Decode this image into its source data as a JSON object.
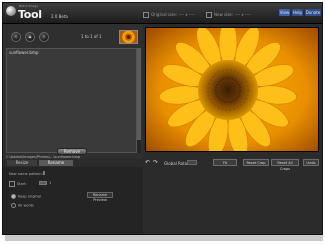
{
  "app": {
    "brand_small": "Batch Image",
    "brand": "Tool",
    "version": "2.0 Beta"
  },
  "title_info": {
    "original": "Original size: ---- x ----",
    "new_size": "New size: ---- x ----"
  },
  "top_buttons": {
    "view": "View",
    "help": "Help",
    "donate": "Donate"
  },
  "toolbar": {
    "prev_icon": "previous-icon",
    "open_icon": "open-icon",
    "next_icon": "next-icon",
    "counter": "1 to 1 of 1"
  },
  "file_list": {
    "items": [
      "sunflower.bmp"
    ]
  },
  "file_path": "C:\\Adobe\\Images\\Photos\\...\\sunflower.bmp",
  "remove_button": "Remove",
  "tabs": {
    "resize": "Resize",
    "rename": "Rename"
  },
  "rename_panel": {
    "new_name_label": "New name pattern:",
    "start_label": "Start:",
    "start_value": "1",
    "option1_label": "Keep original",
    "option2_label": "All words",
    "rename_button": "Rename Preview"
  },
  "bottom_bar": {
    "rotation_label": "Global Rotation:",
    "btn_fit": "Fit",
    "btn_reset_crop": "Reset Crop",
    "btn_reset_all": "Reset All Crops",
    "btn_undo": "Undo"
  },
  "colors": {
    "accent": "#3a5fa8",
    "background": "#2b2b2b"
  }
}
